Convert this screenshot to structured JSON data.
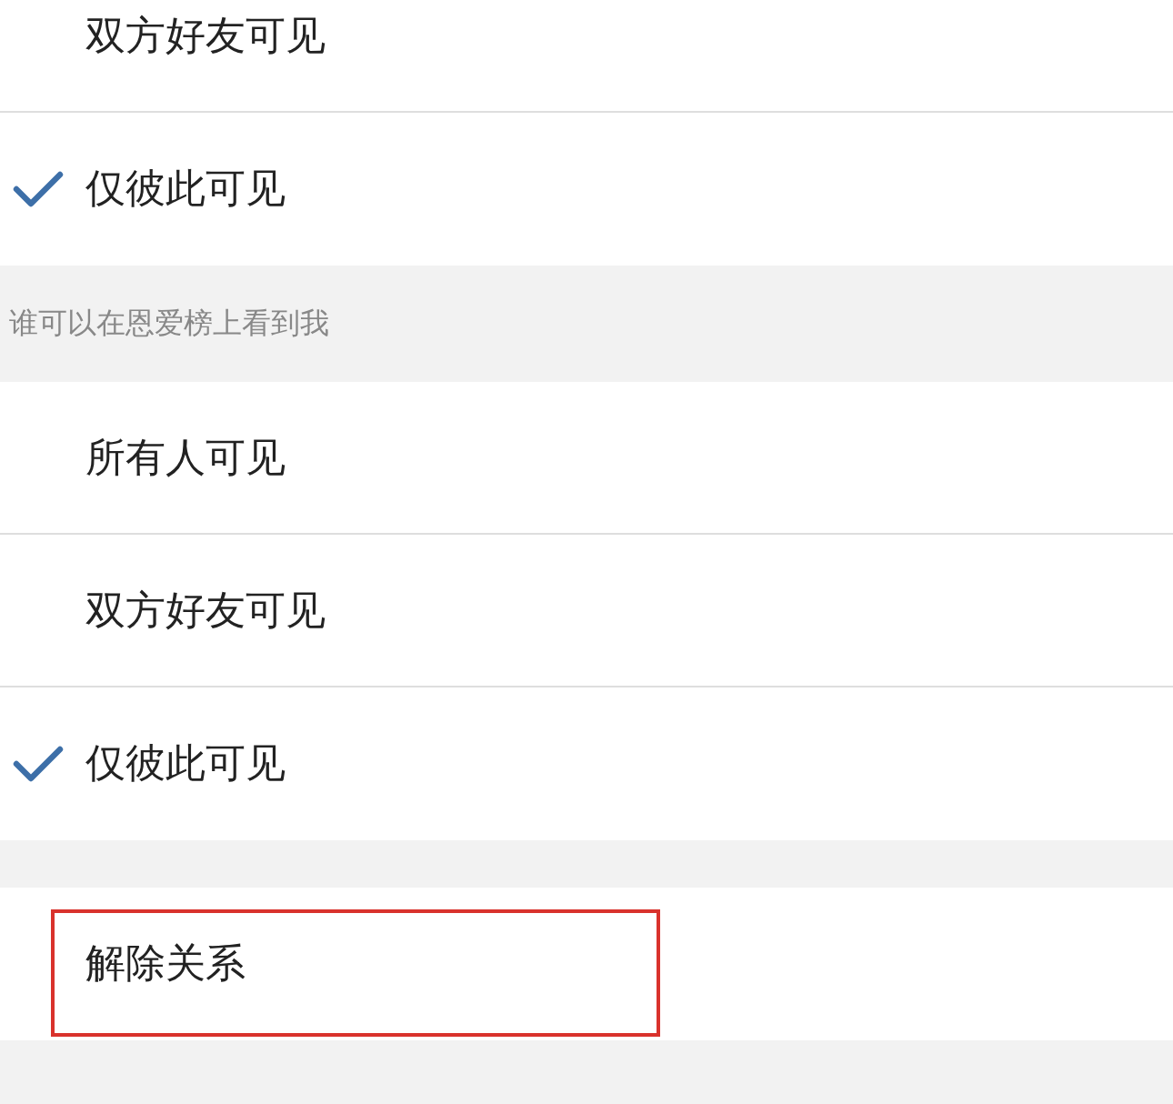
{
  "groups": [
    {
      "items": [
        {
          "label": "双方好友可见",
          "selected": false
        },
        {
          "label": "仅彼此可见",
          "selected": true
        }
      ]
    },
    {
      "header": "谁可以在恩爱榜上看到我",
      "items": [
        {
          "label": "所有人可见",
          "selected": false
        },
        {
          "label": "双方好友可见",
          "selected": false
        },
        {
          "label": "仅彼此可见",
          "selected": true
        }
      ]
    }
  ],
  "action": {
    "label": "解除关系",
    "highlighted": true
  }
}
